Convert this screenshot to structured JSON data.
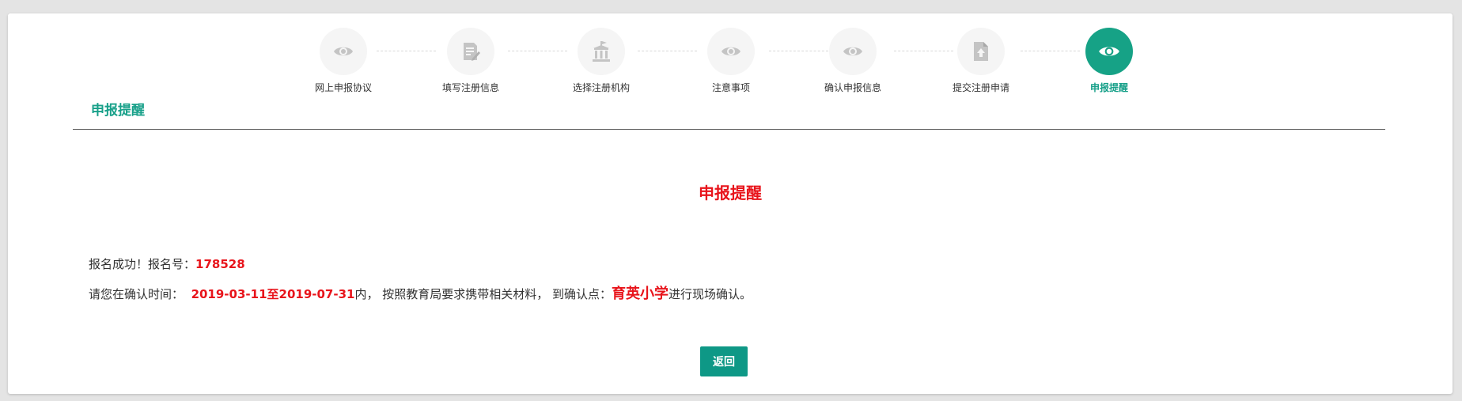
{
  "page": {
    "section_title": "申报提醒"
  },
  "steps": [
    {
      "label": "网上申报协议",
      "icon": "eye-icon",
      "active": false
    },
    {
      "label": "填写注册信息",
      "icon": "edit-document-icon",
      "active": false
    },
    {
      "label": "选择注册机构",
      "icon": "institution-building-icon",
      "active": false
    },
    {
      "label": "注意事项",
      "icon": "eye-icon",
      "active": false
    },
    {
      "label": "确认申报信息",
      "icon": "eye-icon",
      "active": false
    },
    {
      "label": "提交注册申请",
      "icon": "upload-file-icon",
      "active": false
    },
    {
      "label": "申报提醒",
      "icon": "eye-icon",
      "active": true
    }
  ],
  "notice": {
    "heading": "申报提醒",
    "line1_prefix": "报名成功！报名号：",
    "registration_number": "178528",
    "line2_prefix": "请您在确认时间：",
    "date_range": "2019-03-11至2019-07-31",
    "line2_middle": "内， 按照教育局要求携带相关材料， 到确认点：",
    "confirm_location": "育英小学",
    "line2_suffix": "进行现场确认。"
  },
  "actions": {
    "back_label": "返回"
  },
  "colors": {
    "accent": "#16a286",
    "highlight_red": "#e8141b",
    "inactive_icon": "#c4c4c4"
  }
}
